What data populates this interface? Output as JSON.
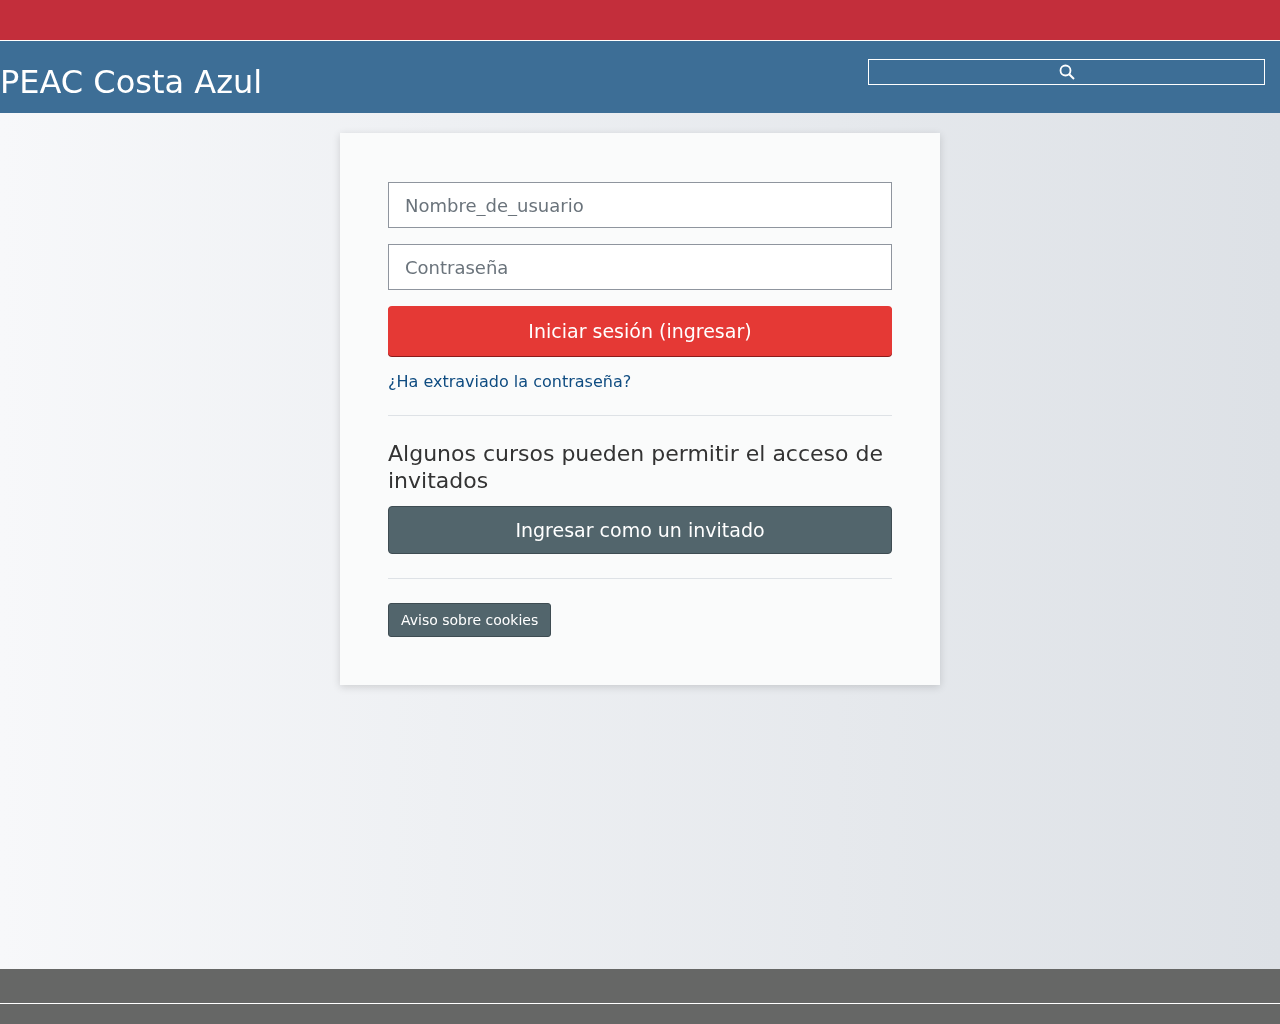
{
  "header": {
    "site_name": "PEAC Costa Azul"
  },
  "login": {
    "username": {
      "placeholder": "Nombre_de_usuario"
    },
    "password": {
      "placeholder": "Contraseña"
    },
    "login_button": "Iniciar sesión (ingresar)",
    "forgot_link": "¿Ha extraviado la contraseña?",
    "guest_heading": "Algunos cursos pueden permitir el acceso de invitados",
    "guest_button": "Ingresar como un invitado",
    "cookies_button": "Aviso sobre cookies"
  }
}
